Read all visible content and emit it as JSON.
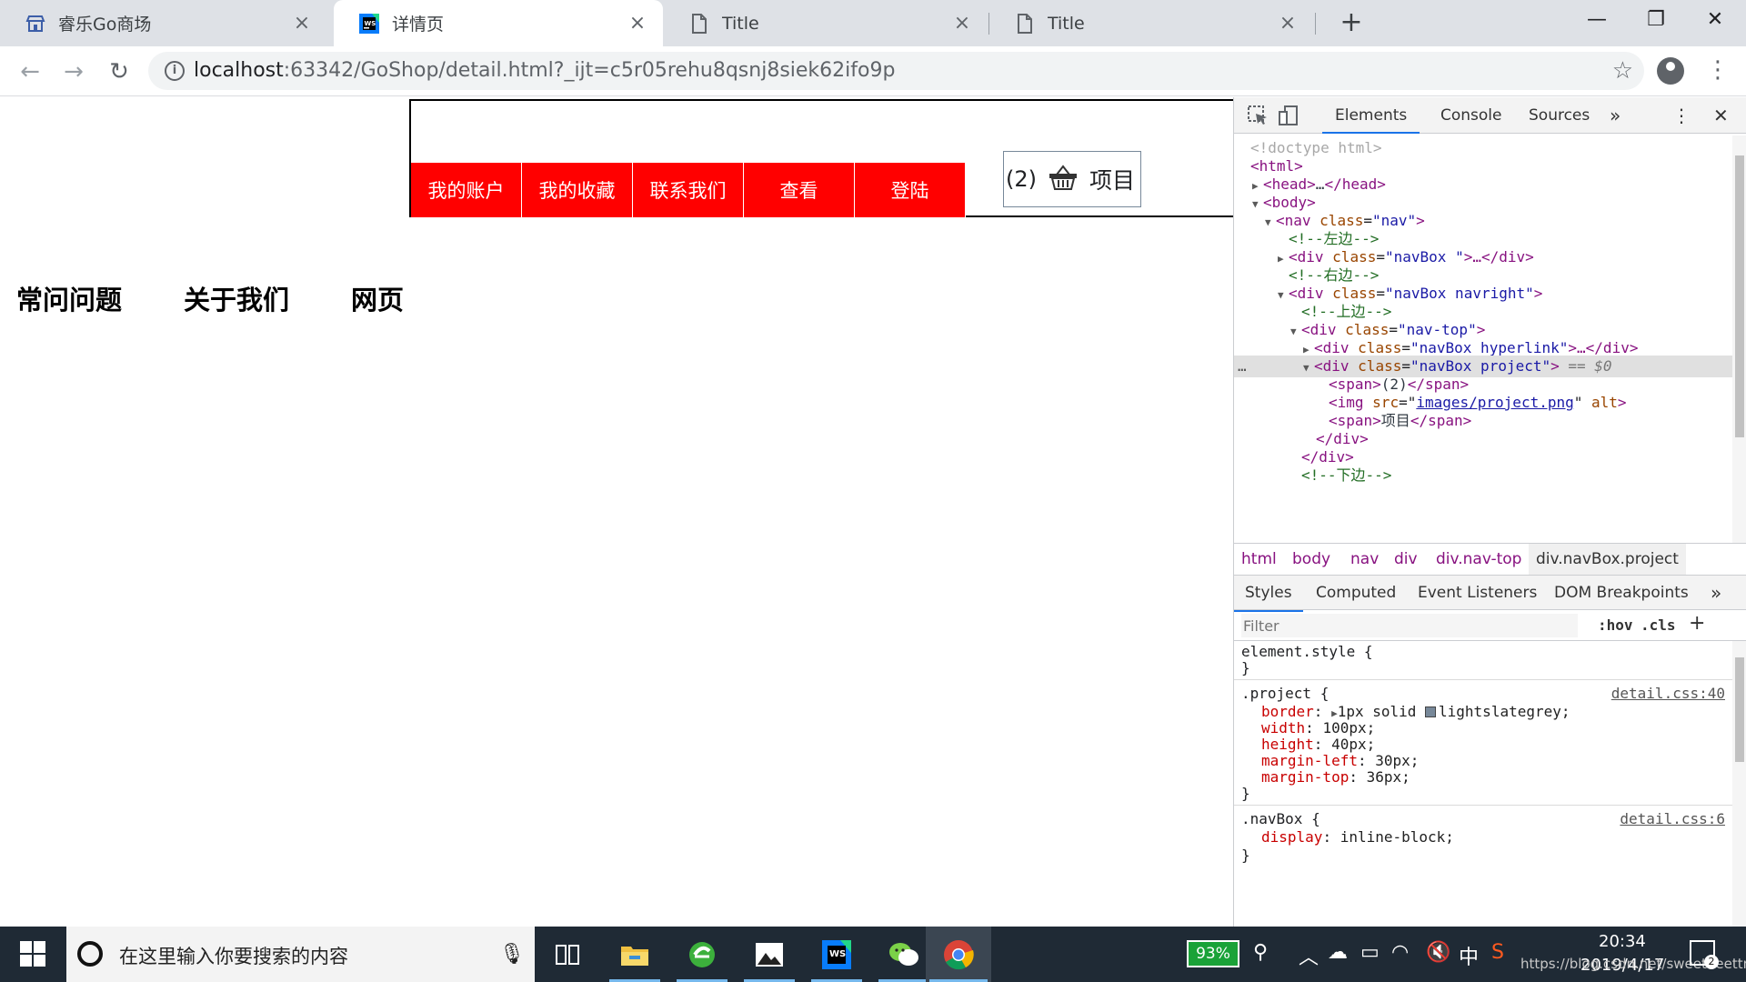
{
  "browser": {
    "tabs": [
      {
        "title": "睿乐Go商场",
        "icon": "store-icon"
      },
      {
        "title": "详情页",
        "icon": "webstorm-icon",
        "active": true
      },
      {
        "title": "Title",
        "icon": "page-icon"
      },
      {
        "title": "Title",
        "icon": "page-icon"
      }
    ],
    "new_tab_label": "+",
    "url_host": "localhost",
    "url_rest": ":63342/GoShop/detail.html?_ijt=c5r05rehu8qsnj8siek62ifo9p"
  },
  "page": {
    "hyperlinks": [
      "我的账户",
      "我的收藏",
      "联系我们",
      "查看",
      "登陆"
    ],
    "project_count": "(2)",
    "project_label": "项目",
    "footer_links": [
      "常问问题",
      "关于我们",
      "网页"
    ],
    "accent_red": "#ff0000",
    "project_border": "#778899"
  },
  "devtools": {
    "tabs": [
      "Elements",
      "Console",
      "Sources"
    ],
    "more": "»",
    "dom": {
      "doctype": "<!doctype html>",
      "html_open": "<html>",
      "head_tag": "<head>",
      "head_ellipsis": "…",
      "head_close": "</head>",
      "body_open": "<body>",
      "nav_tag": "<nav",
      "attr_class": "class",
      "val_nav": "nav",
      "close_bracket": ">",
      "comment_left": "<!--左边-->",
      "div_tag": "<div",
      "val_navbox": "navBox ",
      "ellipsis_close_div": "…</div>",
      "comment_right": "<!--右边-->",
      "val_navbox_navright": "navBox navright",
      "comment_top": "<!--上边-->",
      "val_nav_top": "nav-top",
      "val_navbox_hyperlink": "navBox hyperlink",
      "sel_dots": "…",
      "val_navbox_project": "navBox project",
      "sel_suffix": " == $0",
      "span_open": "<span>",
      "span_count": "(2)",
      "span_close": "</span>",
      "img_tag": "<img",
      "attr_src": "src",
      "val_src": "images/project.png",
      "attr_alt": "alt",
      "span_label": "项目",
      "div_close": "</div>",
      "comment_bottom": "<!--下边-->"
    },
    "breadcrumb": [
      "html",
      "body",
      "nav",
      "div",
      "div.nav-top",
      "div.navBox.project"
    ],
    "style_tabs": [
      "Styles",
      "Computed",
      "Event Listeners",
      "DOM Breakpoints"
    ],
    "filter_placeholder": "Filter",
    "hov": ":hov",
    "cls": ".cls",
    "add": "+",
    "styles": {
      "element_style": "element.style {",
      "close": "}",
      "project_selector": ".project {",
      "project_src": "detail.css:40",
      "project_props": [
        {
          "name": "border",
          "value": "1px solid ",
          "extra": "lightslategrey;"
        },
        {
          "name": "width",
          "value": "100px;"
        },
        {
          "name": "height",
          "value": "40px;"
        },
        {
          "name": "margin-left",
          "value": "30px;"
        },
        {
          "name": "margin-top",
          "value": "36px;"
        }
      ],
      "navbox_selector": ".navBox {",
      "navbox_src": "detail.css:6",
      "navbox_props": [
        {
          "name": "display",
          "value": "inline-block;"
        }
      ]
    }
  },
  "taskbar": {
    "search_placeholder": "在这里输入你要搜索的内容",
    "battery": "93%",
    "ime": "中",
    "time": "20:34",
    "date": "2019/4/17",
    "watermark": "https://blog.csdn.net/sweetbeettmc",
    "notifications": "2"
  }
}
